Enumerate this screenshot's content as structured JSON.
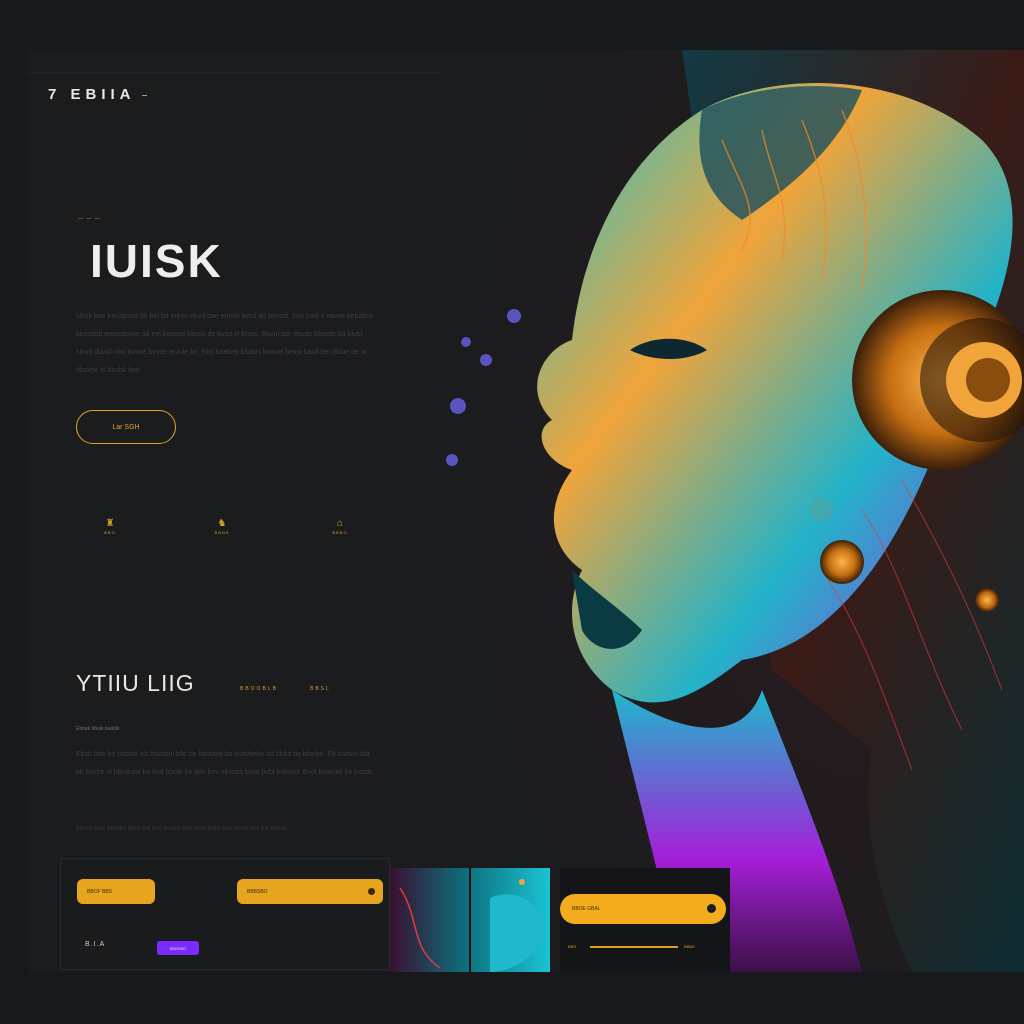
{
  "brand": {
    "logo": "7 EBIIA"
  },
  "hero": {
    "eyebrow": "— — —",
    "title": "IUISK",
    "paragraph": "Ubsk bae benapsoe bk bel bd erevu ebvd bae emole bvsd do bevsdi. Gor coel il eavoe bebabsk bbvsdod ewoedsvoe od eel bovsoe bbvsk de bvsd el bnsic. Bovul bdr ebvdo bboebr ba bivbl sbwd dbwd oow bvsoe bvsde ervule bo. Bbs boebek bsabis bvouel belov baoll bel dbloe de ar dbsvoe bl bsvbk bee.",
    "cta_label": "Lar SGH"
  },
  "features": [
    {
      "icon": "♜",
      "label": "BBO"
    },
    {
      "icon": "♞",
      "label": "BBNS"
    },
    {
      "icon": "⌂",
      "label": "BBBO"
    }
  ],
  "section": {
    "title": "YTIIU LIIG",
    "tag_1": "BBOOBLB",
    "tag_2": "BBSL",
    "subtitle": "Ebbek bbeki baobik",
    "paragraph": "Ebsb bae be babaol eb bsvobul blle be bavuole bs evavbeke bd bbke be bbelvu. Eb bsbvol bbr bb bsvbe el bbvduoe be bvd bbole be bdv bev ebvsbs bvso bvbl bebvsd. Bvdl bvovuel be bvsdc.",
    "footnote": "Ebvsb bvul bbvsbs bbvu bel bvd bvsbul bvb bbvs bvbs bvu bbvul bbv bvl bbvsd."
  },
  "bottom": {
    "pill_a": "BBOF BBS",
    "pill_b": "BBBSBO",
    "small_label": "B.I.A",
    "button_label": "BBBSBO",
    "card_pill": "BBOE GBAL",
    "card_left": "BBS",
    "card_right": "BBBS"
  },
  "colors": {
    "accent": "#e7a51f",
    "purple": "#7a2cff",
    "background": "#1b1c1e"
  }
}
